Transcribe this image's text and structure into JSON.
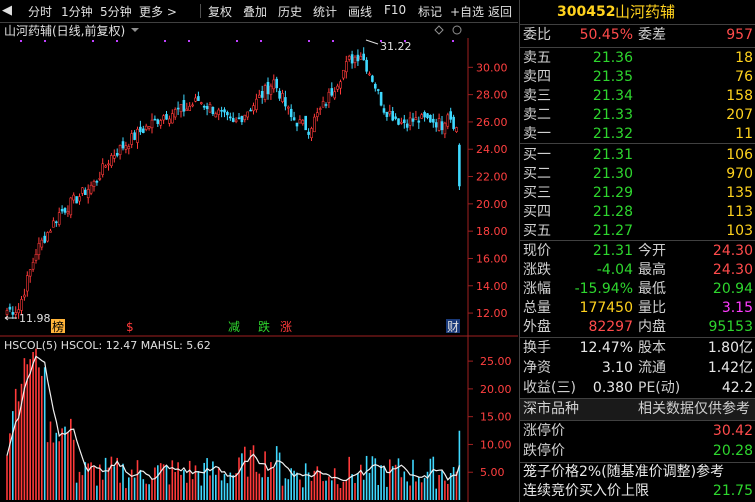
{
  "toolbar": {
    "items": [
      "分时",
      "1分钟",
      "5分钟",
      "更多 >",
      "复权",
      "叠加",
      "历史",
      "统计",
      "画线",
      "F10",
      "标记",
      "+自选",
      "返回"
    ]
  },
  "chart": {
    "title": "山河药辅(日线,前复权)",
    "high_label": "31.22",
    "low_label": "11.98",
    "markers": [
      "榜",
      "$",
      "减",
      "跌",
      "涨",
      "财"
    ],
    "price_axis": [
      "30.00",
      "28.00",
      "26.00",
      "24.00",
      "22.00",
      "20.00",
      "18.00",
      "16.00",
      "14.00",
      "12.00"
    ],
    "price_range": [
      11.2,
      32.0
    ],
    "up_color": "#ff3a3a",
    "down_color": "#3fd9ff",
    "purple_dots_color": "#c040ff"
  },
  "indicator": {
    "label": "HSCOL(5)  HSCOL: 12.47  MAHSL: 5.62",
    "axis": [
      "25.00",
      "20.00",
      "15.00",
      "10.00",
      "5.00"
    ],
    "range": [
      0,
      27
    ]
  },
  "side": {
    "code": "300452",
    "name": "山河药辅",
    "weibi_label": "委比",
    "weibi": "50.45%",
    "weicha_label": "委差",
    "weicha": "957",
    "asks": [
      {
        "label": "卖五",
        "price": "21.36",
        "vol": "18"
      },
      {
        "label": "卖四",
        "price": "21.35",
        "vol": "76"
      },
      {
        "label": "卖三",
        "price": "21.34",
        "vol": "158"
      },
      {
        "label": "卖二",
        "price": "21.33",
        "vol": "207"
      },
      {
        "label": "卖一",
        "price": "21.32",
        "vol": "11"
      }
    ],
    "bids": [
      {
        "label": "买一",
        "price": "21.31",
        "vol": "106"
      },
      {
        "label": "买二",
        "price": "21.30",
        "vol": "970"
      },
      {
        "label": "买三",
        "price": "21.29",
        "vol": "135"
      },
      {
        "label": "买四",
        "price": "21.28",
        "vol": "113"
      },
      {
        "label": "买五",
        "price": "21.27",
        "vol": "103"
      }
    ],
    "stats1": [
      {
        "l1": "现价",
        "v1": "21.31",
        "l2": "今开",
        "v2": "24.30"
      },
      {
        "l1": "涨跌",
        "v1": "-4.04",
        "l2": "最高",
        "v2": "24.30"
      },
      {
        "l1": "涨幅",
        "v1": "-15.94%",
        "l2": "最低",
        "v2": "20.94"
      },
      {
        "l1": "总量",
        "v1": "177450",
        "l2": "量比",
        "v2": "3.15"
      },
      {
        "l1": "外盘",
        "v1": "82297",
        "l2": "内盘",
        "v2": "95153"
      }
    ],
    "stats2": [
      {
        "l1": "换手",
        "v1": "12.47%",
        "l2": "股本",
        "v2": "1.80亿"
      },
      {
        "l1": "净资",
        "v1": "3.10",
        "l2": "流通",
        "v2": "1.42亿"
      },
      {
        "l1": "收益(三)",
        "v1": "0.380",
        "l2": "PE(动)",
        "v2": "42.2"
      }
    ],
    "market_label": "深市品种",
    "market_note": "相关数据仅供参考",
    "limit_up_label": "涨停价",
    "limit_up": "30.42",
    "limit_down_label": "跌停价",
    "limit_down": "20.28",
    "cage_text": "笼子价格2%(随基准价调整)参考",
    "auction_label": "连续竞价买入价上限",
    "auction_value": "21.75"
  }
}
